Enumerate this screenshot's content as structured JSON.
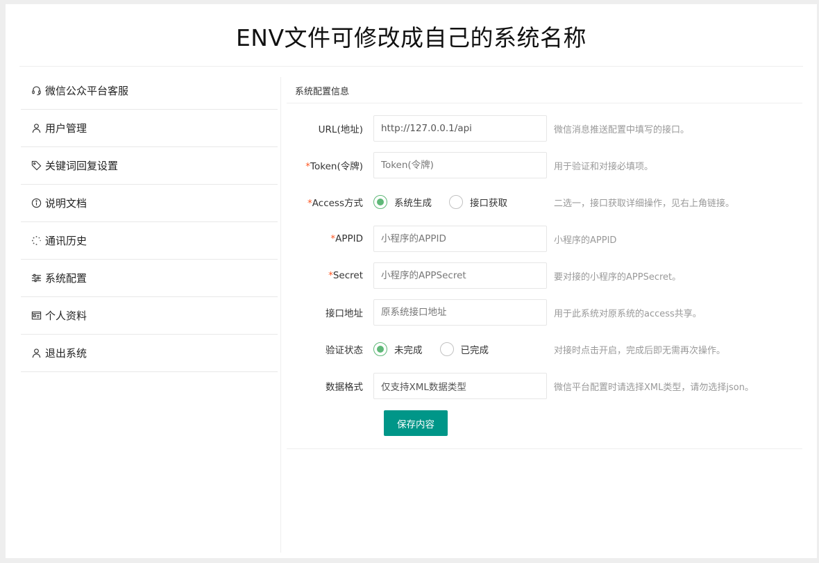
{
  "header": {
    "title": "ENV文件可修改成自己的系统名称"
  },
  "sidebar": {
    "items": [
      {
        "label": "微信公众平台客服",
        "icon": "headset-icon"
      },
      {
        "label": "用户管理",
        "icon": "user-icon"
      },
      {
        "label": "关键词回复设置",
        "icon": "tag-icon"
      },
      {
        "label": "说明文档",
        "icon": "info-icon"
      },
      {
        "label": "通讯历史",
        "icon": "loading-icon"
      },
      {
        "label": "系统配置",
        "icon": "sliders-icon"
      },
      {
        "label": "个人资料",
        "icon": "id-card-icon"
      },
      {
        "label": "退出系统",
        "icon": "user-icon"
      }
    ]
  },
  "panel": {
    "title": "系统配置信息",
    "url": {
      "label": "URL(地址)",
      "value": "http://127.0.0.1/api",
      "tip": "微信消息推送配置中填写的接口。"
    },
    "token": {
      "required": "*",
      "label": "Token(令牌)",
      "placeholder": "Token(令牌)",
      "tip": "用于验证和对接必填项。"
    },
    "access": {
      "required": "*",
      "label": "Access方式",
      "option1": "系统生成",
      "option2": "接口获取",
      "selected": "系统生成",
      "tip": "二选一，接口获取详细操作，见右上角链接。"
    },
    "appid": {
      "required": "*",
      "label": "APPID",
      "placeholder": "小程序的APPID",
      "tip": "小程序的APPID"
    },
    "secret": {
      "required": "*",
      "label": "Secret",
      "placeholder": "小程序的APPSecret",
      "tip": "要对接的小程序的APPSecret。"
    },
    "api_address": {
      "label": "接口地址",
      "placeholder": "原系统接口地址",
      "tip": "用于此系统对原系统的access共享。"
    },
    "verify": {
      "label": "验证状态",
      "option1": "未完成",
      "option2": "已完成",
      "selected": "未完成",
      "tip": "对接时点击开启，完成后即无需再次操作。"
    },
    "format": {
      "label": "数据格式",
      "value": "仅支持XML数据类型",
      "tip": "微信平台配置时请选择XML类型，请勿选择json。"
    },
    "save_label": "保存内容"
  },
  "colors": {
    "accent": "#009688",
    "radio": "#5fb878",
    "required": "#ff5722"
  }
}
